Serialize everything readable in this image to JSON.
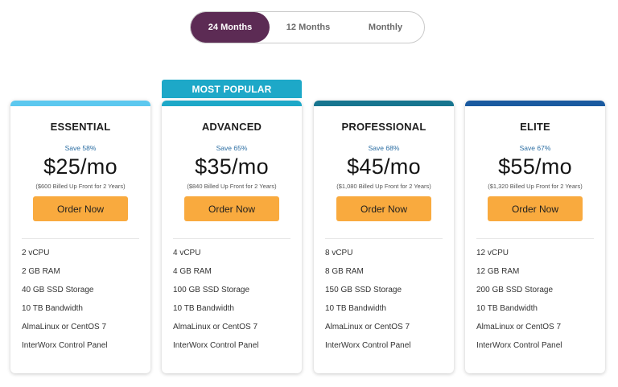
{
  "billing_toggle": {
    "options": [
      "24 Months",
      "12 Months",
      "Monthly"
    ],
    "selected": "24 Months",
    "active_color": "#5c2b54"
  },
  "popular_banner": "MOST POPULAR",
  "plans": [
    {
      "name": "ESSENTIAL",
      "accent_color": "#5cc8ef",
      "save": "Save 58%",
      "price": "$25/mo",
      "billed": "($600 Billed Up Front for 2 Years)",
      "button": "Order Now",
      "features": [
        "2 vCPU",
        "2 GB RAM",
        "40 GB SSD Storage",
        "10 TB Bandwidth",
        "AlmaLinux or CentOS 7",
        "InterWorx Control Panel"
      ]
    },
    {
      "name": "ADVANCED",
      "accent_color": "#1da8c8",
      "save": "Save 65%",
      "price": "$35/mo",
      "billed": "($840 Billed Up Front for 2 Years)",
      "button": "Order Now",
      "features": [
        "4 vCPU",
        "4 GB RAM",
        "100 GB SSD Storage",
        "10 TB Bandwidth",
        "AlmaLinux or CentOS 7",
        "InterWorx Control Panel"
      ]
    },
    {
      "name": "PROFESSIONAL",
      "accent_color": "#17758f",
      "save": "Save 68%",
      "price": "$45/mo",
      "billed": "($1,080 Billed Up Front for 2 Years)",
      "button": "Order Now",
      "features": [
        "8 vCPU",
        "8 GB RAM",
        "150 GB SSD Storage",
        "10 TB Bandwidth",
        "AlmaLinux or CentOS 7",
        "InterWorx Control Panel"
      ]
    },
    {
      "name": "ELITE",
      "accent_color": "#1a5aa0",
      "save": "Save 67%",
      "price": "$55/mo",
      "billed": "($1,320 Billed Up Front for 2 Years)",
      "button": "Order Now",
      "features": [
        "12 vCPU",
        "12 GB RAM",
        "200 GB SSD Storage",
        "10 TB Bandwidth",
        "AlmaLinux or CentOS 7",
        "InterWorx Control Panel"
      ]
    }
  ],
  "colors": {
    "button": "#f9aa3e",
    "save_text": "#2c6ea3"
  }
}
